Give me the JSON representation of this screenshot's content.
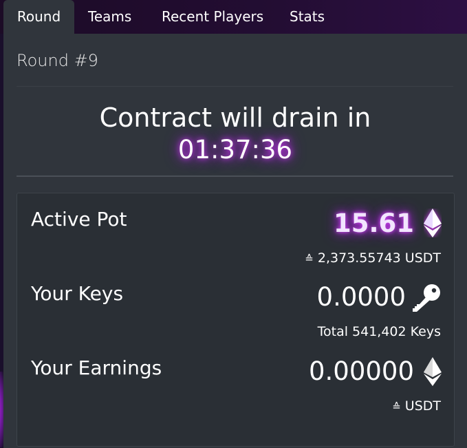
{
  "tabs": [
    {
      "label": "Round",
      "active": true
    },
    {
      "label": "Teams",
      "active": false
    },
    {
      "label": "Recent Players",
      "active": false
    },
    {
      "label": "Stats",
      "active": false
    }
  ],
  "round": {
    "title": "Round #9",
    "drain_text": "Contract will drain in",
    "timer": "01:37:36"
  },
  "pot": {
    "label": "Active Pot",
    "value": "15.61",
    "sub_icon": "≙",
    "sub_value": "2,373.55743 USDT",
    "icon": "ethereum-icon"
  },
  "keys": {
    "label": "Your Keys",
    "value": "0.0000",
    "sub_value": "Total 541,402 Keys",
    "icon": "key-icon"
  },
  "earnings": {
    "label": "Your Earnings",
    "value": "0.00000",
    "sub_icon": "≙",
    "sub_value": "USDT",
    "icon": "ethereum-icon"
  },
  "colors": {
    "panel": "#30353c",
    "card": "#2a2f35",
    "glow": "#c73ae8",
    "tabbar": "#1c0b26"
  }
}
